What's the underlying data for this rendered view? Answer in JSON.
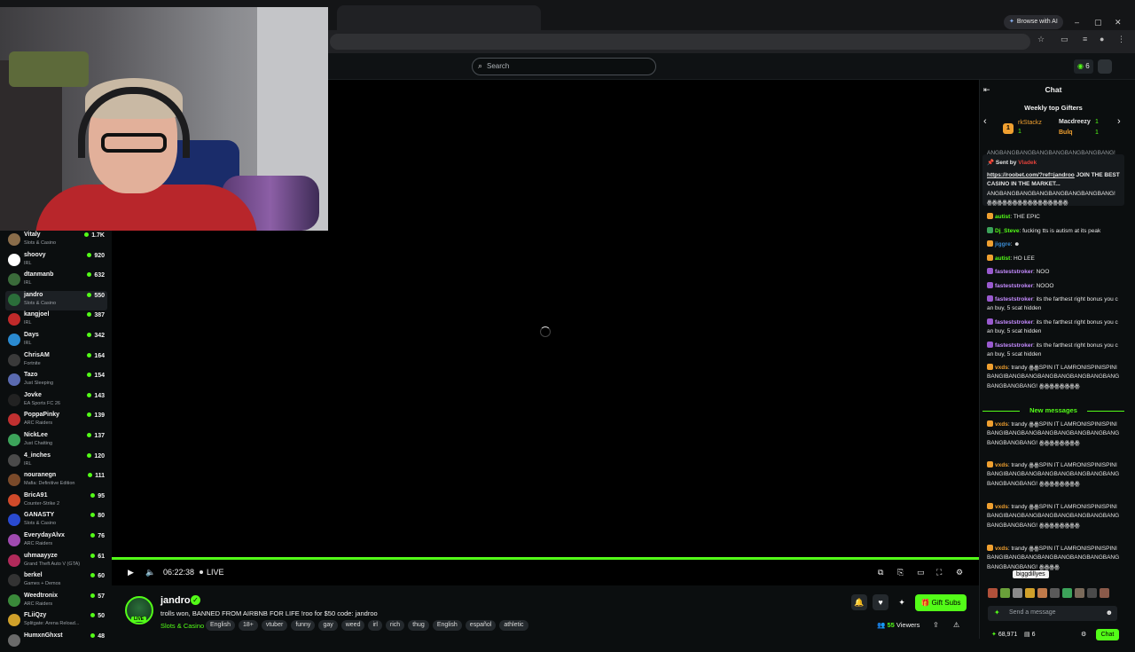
{
  "browser": {
    "ai_button": "Browse with AI",
    "minimize": "–",
    "maximize": "▢",
    "close": "✕"
  },
  "nav": {
    "search_placeholder": "Search",
    "coins": "6"
  },
  "sidebar": {
    "channels": [
      {
        "name": "Vitaly",
        "category": "Slots & Casino",
        "viewers": "1.7K",
        "color": "#8a6d4a"
      },
      {
        "name": "shoovy",
        "category": "IRL",
        "viewers": "920",
        "color": "#ffffff"
      },
      {
        "name": "dtanmanb",
        "category": "IRL",
        "viewers": "632",
        "color": "#3a6b3a"
      },
      {
        "name": "jandro",
        "category": "Slots & Casino",
        "viewers": "550",
        "color": "#2b6e3a"
      },
      {
        "name": "kangjoel",
        "category": "IRL",
        "viewers": "387",
        "color": "#c02a2a"
      },
      {
        "name": "Days",
        "category": "IRL",
        "viewers": "342",
        "color": "#2a8ad0"
      },
      {
        "name": "ChrisAM",
        "category": "Fortnite",
        "viewers": "164",
        "color": "#3a3a3a"
      },
      {
        "name": "Tazo",
        "category": "Just Sleeping",
        "viewers": "154",
        "color": "#5a6ab0"
      },
      {
        "name": "Jovke",
        "category": "EA Sports FC 26",
        "viewers": "143",
        "color": "#222222"
      },
      {
        "name": "PoppaPinky",
        "category": "ARC Raiders",
        "viewers": "139",
        "color": "#c03030"
      },
      {
        "name": "NickLee",
        "category": "Just Chatting",
        "viewers": "137",
        "color": "#3ca35a"
      },
      {
        "name": "4_inches",
        "category": "IRL",
        "viewers": "120",
        "color": "#4a4a4a"
      },
      {
        "name": "nouranegn",
        "category": "Mafia: Definitive Edition",
        "viewers": "111",
        "color": "#7a4a2a"
      },
      {
        "name": "BricA91",
        "category": "Counter-Strike 2",
        "viewers": "95",
        "color": "#d04a2a"
      },
      {
        "name": "GANASTY",
        "category": "Slots & Casino",
        "viewers": "80",
        "color": "#2a4ad0"
      },
      {
        "name": "EverydayAlvx",
        "category": "ARC Raiders",
        "viewers": "76",
        "color": "#a04ab0"
      },
      {
        "name": "uhmaayyze",
        "category": "Grand Theft Auto V (GTA)",
        "viewers": "61",
        "color": "#b02a5a"
      },
      {
        "name": "berkel",
        "category": "Games + Demos",
        "viewers": "60",
        "color": "#333333"
      },
      {
        "name": "Weedtronix",
        "category": "ARC Raiders",
        "viewers": "57",
        "color": "#3a8a3a"
      },
      {
        "name": "FLiiQzy",
        "category": "Splitgate: Arena Reload...",
        "viewers": "50",
        "color": "#d0a02a"
      },
      {
        "name": "HumxnGhxst",
        "category": "",
        "viewers": "48",
        "color": "#6a6a6a"
      }
    ]
  },
  "player": {
    "time": "06:22:38",
    "live": "LIVE",
    "progress": 1.0
  },
  "stream": {
    "streamer": "jandro",
    "live_badge": "LIVE",
    "title": "trolls won, BANNED FROM AIRBNB FOR LIFE !roo for $50 code: jandroo",
    "category": "Slots & Casino",
    "tags": [
      "English",
      "18+",
      "vtuber",
      "funny",
      "gay",
      "weed",
      "irl",
      "rich",
      "thug",
      "English",
      "español",
      "athletic"
    ],
    "gift_subs": "Gift Subs",
    "viewers_count": "55",
    "viewers_label": "Viewers"
  },
  "chat": {
    "title": "Chat",
    "gifters_title": "Weekly top Gifters",
    "gifters": [
      {
        "name": "rkStackz",
        "count": "1",
        "color": "#f0a030"
      },
      {
        "name": "Macdreezy",
        "count": "1",
        "color": "#e6e6e6"
      },
      {
        "name": "Bulq",
        "count": "1",
        "color": "#f0a030"
      }
    ],
    "rank_badge": "1",
    "pinned": {
      "sent_by": "Sent by",
      "sender": "Vladek",
      "link": "https://roobet.com/?ref=jandroo",
      "text": "JOIN THE BEST CASINO IN THE MARKET...",
      "top_cut": "ANGBANGBANGBANGBANGBANGBANGBANG!"
    },
    "messages": [
      {
        "user": "",
        "text": "ANGBANGBANGBANGBANGBANGBANGBANG! ꙮꙮꙮꙮꙮꙮꙮꙮꙮꙮꙮꙮꙮꙮꙮꙮ",
        "ucolor": "#e6e6e6",
        "badge": ""
      },
      {
        "user": "autist",
        "text": ": THE EPIC",
        "ucolor": "#53fc18",
        "badge": "#f0a030"
      },
      {
        "user": "Dj_Steve",
        "text": ": fucking tts is autism at its peak",
        "ucolor": "#53fc18",
        "badge": "#3ca35a"
      },
      {
        "user": "jiggre",
        "text": ": ☻",
        "ucolor": "#3a8ad0",
        "badge": "#f0a030"
      },
      {
        "user": "autist",
        "text": ": HO LEE",
        "ucolor": "#53fc18",
        "badge": "#f0a030"
      },
      {
        "user": "fasteststroker",
        "text": ": NOO",
        "ucolor": "#c58bff",
        "badge": "#9a5ad0"
      },
      {
        "user": "fasteststroker",
        "text": ": NOOO",
        "ucolor": "#c58bff",
        "badge": "#9a5ad0"
      },
      {
        "user": "fasteststroker",
        "text": ": its the farthest right bonus you can buy, 5 scat hidden",
        "ucolor": "#c58bff",
        "badge": "#9a5ad0"
      },
      {
        "user": "fasteststroker",
        "text": ": its the farthest right bonus you can buy, 5 scat hidden",
        "ucolor": "#c58bff",
        "badge": "#9a5ad0"
      },
      {
        "user": "fasteststroker",
        "text": ": its the farthest right bonus you can buy, 5 scat hidden",
        "ucolor": "#c58bff",
        "badge": "#9a5ad0"
      },
      {
        "user": "vxds",
        "text": ": trandy ꙮꙮSPIN IT LAMRONISPINISPINIBANGIBANGBANGBANGBANGBANGBANGBANGBANGBANGBANG! ꙮꙮꙮꙮꙮꙮꙮꙮ",
        "ucolor": "#f0a030",
        "badge": "#f0a030"
      }
    ],
    "new_messages": "New messages",
    "new": [
      {
        "user": "vxds",
        "text": ": trandy ꙮꙮSPIN IT LAMRONISPINISPINIBANGIBANGBANGBANGBANGBANGBANGBANGBANGBANGBANG! ꙮꙮꙮꙮꙮꙮꙮꙮ",
        "ucolor": "#f0a030",
        "badge": "#f0a030"
      },
      {
        "user": "vxds",
        "text": ": trandy ꙮꙮSPIN IT LAMRONISPINISPINIBANGIBANGBANGBANGBANGBANGBANGBANGBANGBANGBANG! ꙮꙮꙮꙮꙮꙮꙮꙮ",
        "ucolor": "#f0a030",
        "badge": "#f0a030"
      },
      {
        "user": "vxds",
        "text": ": trandy ꙮꙮSPIN IT LAMRONISPINISPINIBANGIBANGBANGBANGBANGBANGBANGBANGBANGBANGBANG! ꙮꙮꙮꙮꙮꙮꙮꙮ",
        "ucolor": "#f0a030",
        "badge": "#f0a030"
      },
      {
        "user": "vxds",
        "text": ": trandy ꙮꙮSPIN IT LAMRONISPINISPINIBANGIBANGBANGBANGBANGBANGBANGBANGBANGBANGBANG! ꙮꙮꙮꙮ",
        "ucolor": "#f0a030",
        "badge": "#f0a030"
      }
    ],
    "tooltip": "biggdillyes",
    "input_placeholder": "Send a message",
    "balance": "68,971",
    "points": "6",
    "chat_button": "Chat"
  },
  "colors": {
    "accent": "#53fc18",
    "background": "#0b0e0f"
  }
}
